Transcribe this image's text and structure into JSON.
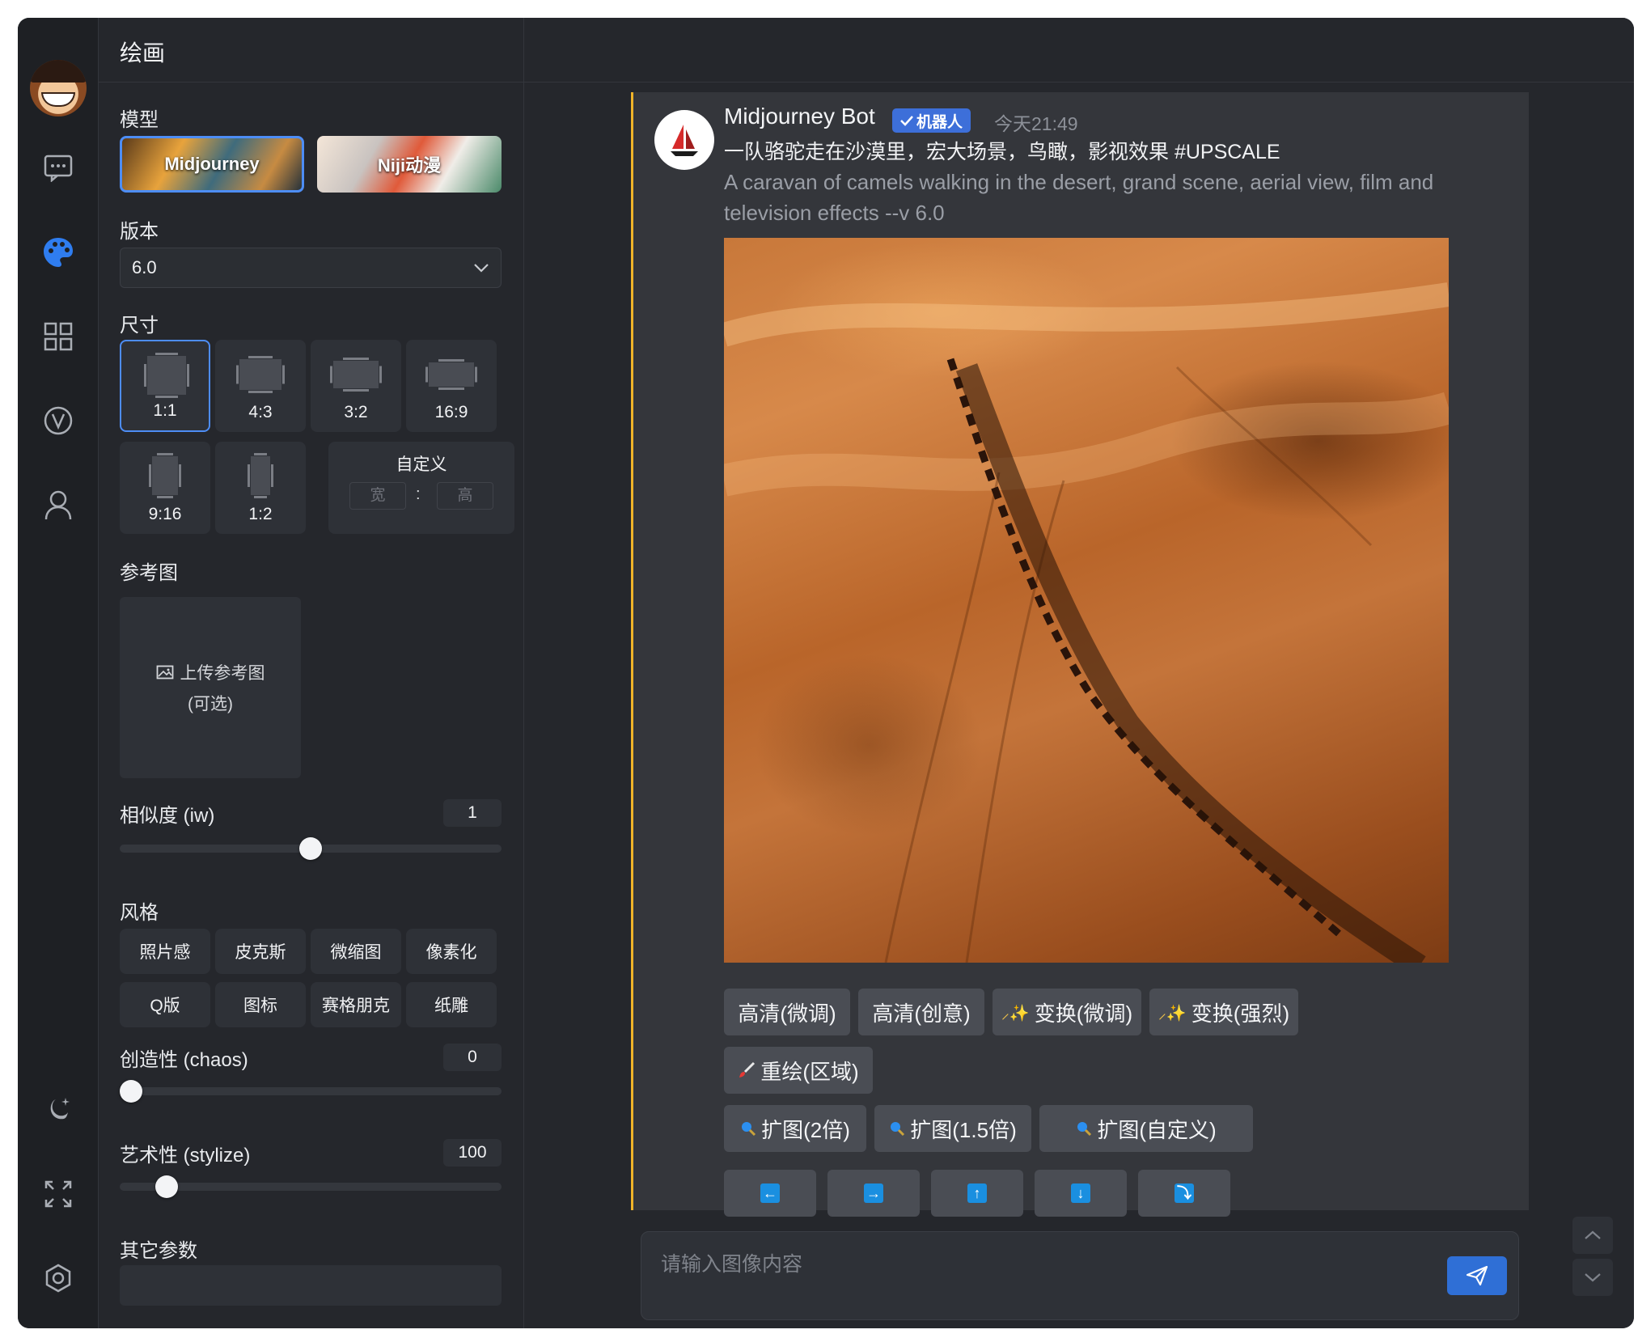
{
  "panel": {
    "title": "绘画",
    "model_label": "模型",
    "models": [
      {
        "label": "Midjourney",
        "selected": true
      },
      {
        "label": "Niji动漫",
        "selected": false
      }
    ],
    "version_label": "版本",
    "version_value": "6.0",
    "size_label": "尺寸",
    "sizes": [
      "1:1",
      "4:3",
      "3:2",
      "16:9",
      "9:16",
      "1:2"
    ],
    "selected_size": "1:1",
    "custom": {
      "title": "自定义",
      "width_placeholder": "宽",
      "height_placeholder": "高",
      "separator": ":"
    },
    "ref_label": "参考图",
    "ref_upload_line1": "上传参考图",
    "ref_upload_line2": "(可选)",
    "similarity_label": "相似度 (iw)",
    "similarity_value": "1",
    "style_label": "风格",
    "styles": [
      "照片感",
      "皮克斯",
      "微缩图",
      "像素化",
      "Q版",
      "图标",
      "赛格朋克",
      "纸雕"
    ],
    "chaos_label": "创造性 (chaos)",
    "chaos_value": "0",
    "stylize_label": "艺术性 (stylize)",
    "stylize_value": "100",
    "other_label": "其它参数"
  },
  "message": {
    "bot_name": "Midjourney Bot",
    "badge": "机器人",
    "time": "今天21:49",
    "prompt_cn": "一队骆驼走在沙漠里，宏大场景，鸟瞰，影视效果 #UPSCALE",
    "prompt_en": "A caravan of camels walking in the desert, grand scene, aerial view, film and television effects --v 6.0",
    "actions_row1": [
      "高清(微调)",
      "高清(创意)",
      "变换(微调)",
      "变换(强烈)"
    ],
    "actions_row2": [
      "重绘(区域)"
    ],
    "actions_row3": [
      "扩图(2倍)",
      "扩图(1.5倍)",
      "扩图(自定义)"
    ],
    "arrows": [
      "←",
      "→",
      "↑",
      "↓",
      "⤵"
    ]
  },
  "composer": {
    "placeholder": "请输入图像内容"
  },
  "colors": {
    "accent": "#4d8df5",
    "message_border": "#f0b429",
    "send": "#2f6fd6"
  }
}
